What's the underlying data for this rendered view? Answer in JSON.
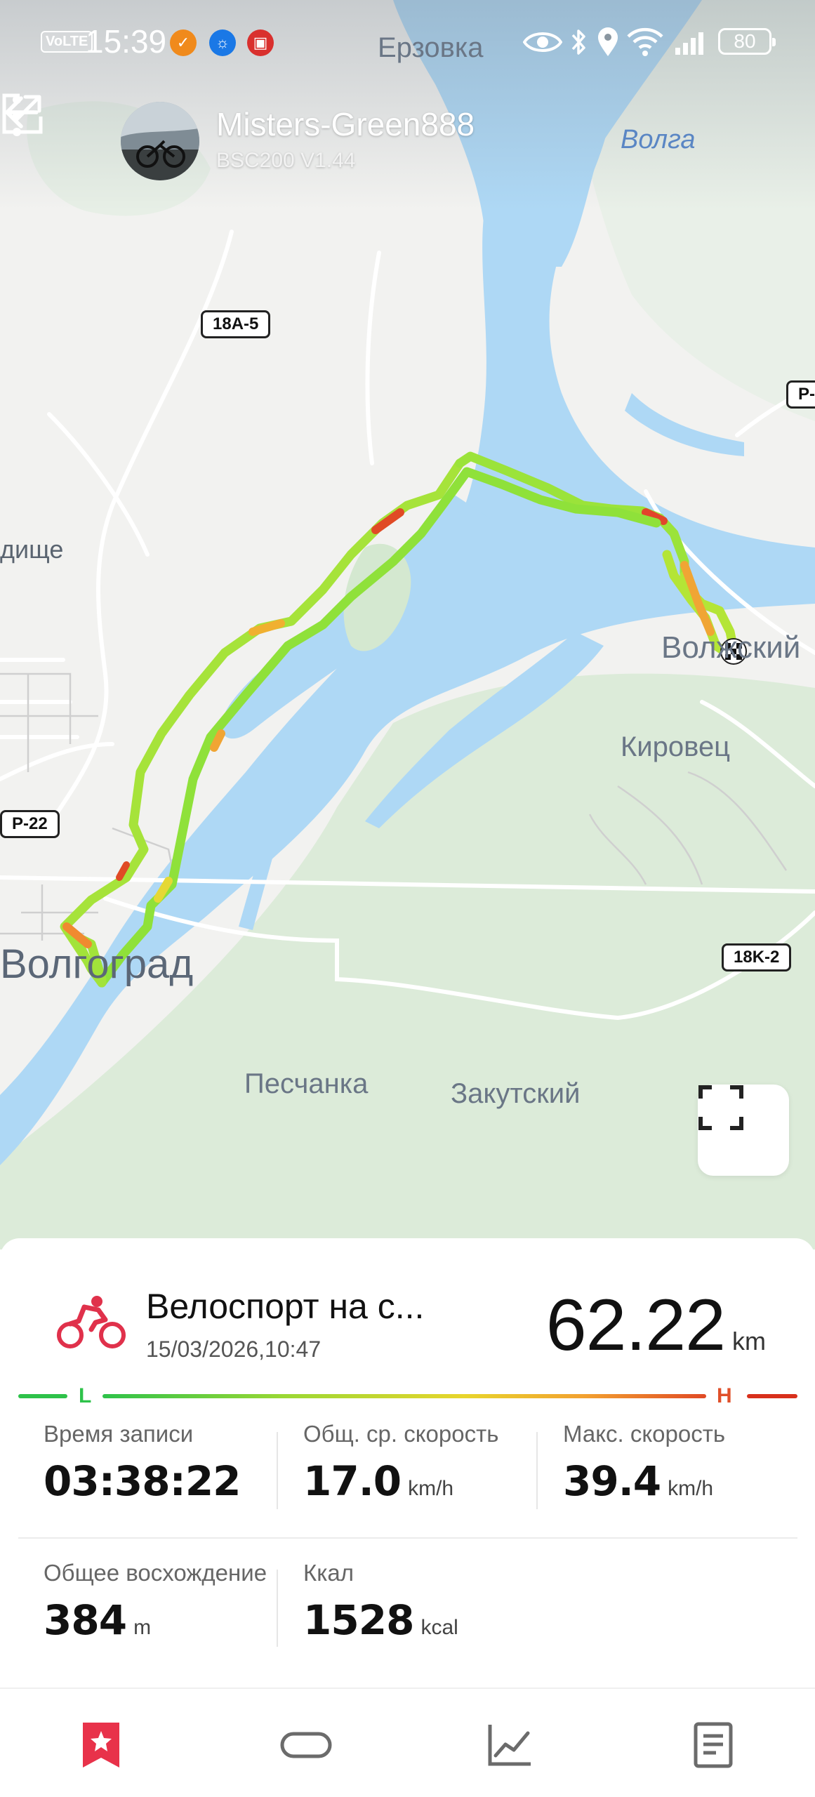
{
  "status_bar": {
    "volte": "VoLTE",
    "time": "15:39",
    "battery": "80",
    "icons": [
      "notification-app-icon",
      "lightbulb-icon",
      "app-icon",
      "eye-icon",
      "bluetooth-icon",
      "location-icon",
      "wifi-icon",
      "signal-icon",
      "battery-icon"
    ]
  },
  "header": {
    "user_name": "Misters-Green888",
    "device": "BSC200  V1.44"
  },
  "map": {
    "place_labels": {
      "erzovka": "Ерзовка",
      "volga": "Волга",
      "gorodishche": "дище",
      "volzhsky": "Волжский",
      "kirovets": "Кировец",
      "volgograd": "Волгоград",
      "peschanka": "Песчанка",
      "zakutsky": "Закутский"
    },
    "road_badges": {
      "r1": "18A-5",
      "r2": "P-",
      "r3": "P-22",
      "r4": "18K-2"
    },
    "colors": {
      "water": "#aed8f5",
      "land": "#f2f2f0",
      "green_area": "#d6e7d4",
      "track_low": "#4fd84a",
      "track_mid": "#c9e82c",
      "track_high": "#e04a25"
    }
  },
  "activity": {
    "sport": "Велоспорт на с...",
    "datetime": "15/03/2026,10:47",
    "distance": "62.22",
    "distance_unit": "km",
    "sport_color": "#e0314b"
  },
  "legend": {
    "low": "L",
    "high": "H"
  },
  "stats": {
    "duration": {
      "label": "Время записи",
      "value": "03:38:22"
    },
    "avg_speed": {
      "label": "Общ. ср. скорость",
      "value": "17.0",
      "unit": "km/h"
    },
    "max_speed": {
      "label": "Макс. скорость",
      "value": "39.4",
      "unit": "km/h"
    },
    "ascent": {
      "label": "Общее восхождение",
      "value": "384",
      "unit": "m"
    },
    "calories": {
      "label": "Ккал",
      "value": "1528",
      "unit": "kcal"
    }
  },
  "nav": {
    "items": [
      "bookmark-icon",
      "loop-icon",
      "chart-icon",
      "document-icon"
    ],
    "active_color": "#e8324a"
  }
}
